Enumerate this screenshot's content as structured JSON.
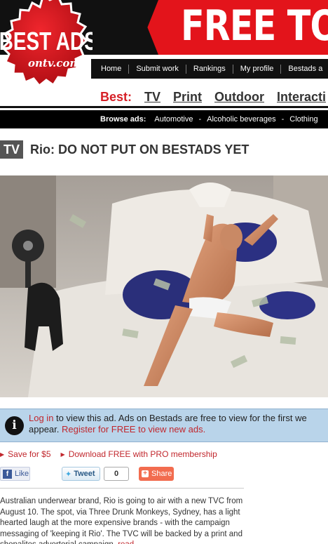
{
  "logo": {
    "line1": "BEST ADS",
    "line2": "ontv.com"
  },
  "banner": {
    "text": "FREE TO"
  },
  "nav": {
    "items": [
      "Home",
      "Submit work",
      "Rankings",
      "My profile",
      "Bestads a"
    ]
  },
  "best": {
    "label": "Best:",
    "links": [
      "TV",
      "Print",
      "Outdoor",
      "Interacti"
    ]
  },
  "browse": {
    "label": "Browse ads:",
    "categories": [
      "Automotive",
      "Alcoholic beverages",
      "Clothing"
    ],
    "separator": "-"
  },
  "ad": {
    "type_badge": "TV",
    "title": "Rio: DO NOT PUT ON BESTADS YET"
  },
  "info": {
    "login_link": "Log in",
    "line1_text": " to view this ad. Ads on Bestads are free to view for the first we",
    "line2_text": "appear. ",
    "register_link": "Register for FREE to view new ads."
  },
  "actions": {
    "save": "Save for $5",
    "download": "Download FREE with PRO membership"
  },
  "social": {
    "like": "Like",
    "tweet": "Tweet",
    "tweet_count": "0",
    "share": "Share"
  },
  "description": {
    "text": "Australian underwear brand, Rio is going to air with a new TVC from August 10. The spot, via Three Drunk Monkeys, Sydney, has a light hearted laugh at the more expensive brands - with the campaign messaging of 'keeping it Rio'. The TVC will be backed by a print and shopalites advertorial campaign. ",
    "more_link": "read"
  },
  "colors": {
    "brand_red": "#e3141b",
    "link_red": "#c1272d",
    "info_bg": "#b9d4ea"
  }
}
